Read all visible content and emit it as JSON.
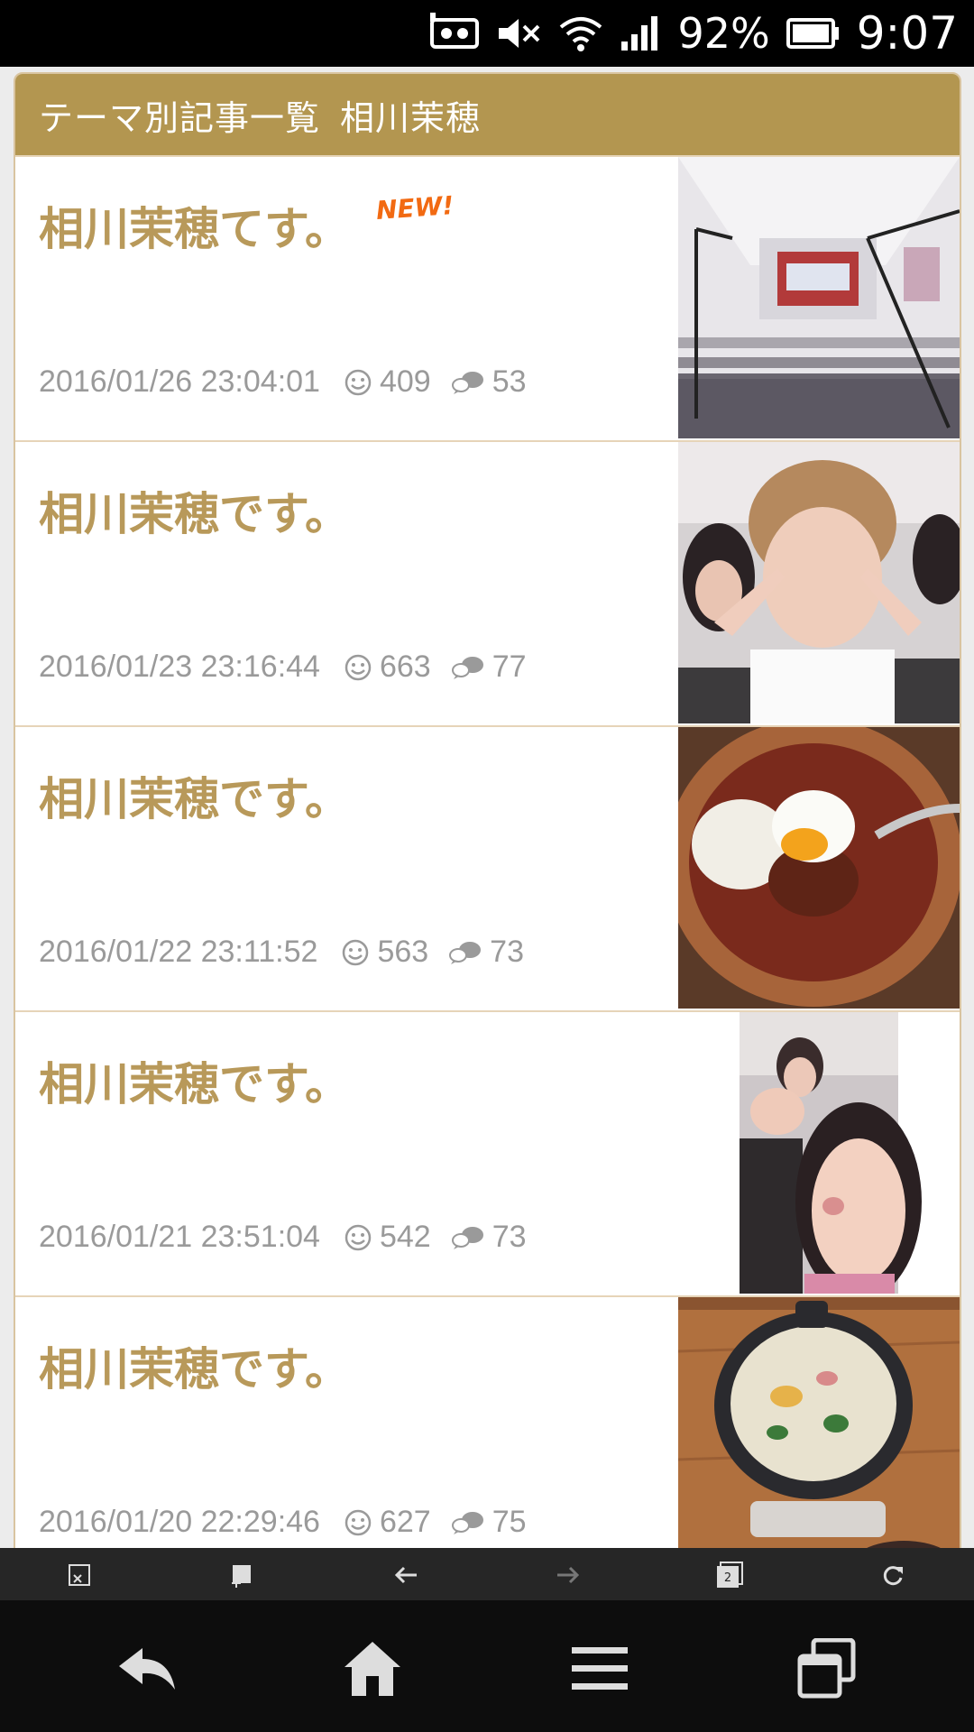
{
  "status_bar": {
    "battery_percent": "92%",
    "time": "9:07",
    "icons": [
      "nfc-icon",
      "mute-icon",
      "wifi-icon",
      "signal-icon",
      "battery-icon"
    ]
  },
  "header": {
    "title": "テーマ別記事一覧",
    "theme": "相川茉穂"
  },
  "entries": [
    {
      "title": "相川茉穂てす。",
      "badge": "NEW!",
      "date": "2016/01/26 23:04:01",
      "likes": "409",
      "comments": "53",
      "thumb": "gallery-photo"
    },
    {
      "title": "相川茉穂です。",
      "date": "2016/01/23 23:16:44",
      "likes": "663",
      "comments": "77",
      "thumb": "selfie-photo"
    },
    {
      "title": "相川茉穂です。",
      "date": "2016/01/22 23:11:52",
      "likes": "563",
      "comments": "73",
      "thumb": "curry-photo"
    },
    {
      "title": "相川茉穂です。",
      "date": "2016/01/21 23:51:04",
      "likes": "542",
      "comments": "73",
      "thumb": "friends-photo"
    },
    {
      "title": "相川茉穂です。",
      "date": "2016/01/20 22:29:46",
      "likes": "627",
      "comments": "75",
      "thumb": "stew-photo"
    }
  ],
  "browser_toolbar": {
    "tab_count": "2",
    "buttons": [
      "close-tab-icon",
      "add-bookmark-icon",
      "back-arrow-icon",
      "forward-arrow-icon",
      "tabs-icon",
      "reload-icon"
    ]
  },
  "nav_bar": {
    "buttons": [
      "back-icon",
      "home-icon",
      "menu-icon",
      "recent-apps-icon"
    ]
  },
  "colors": {
    "accent": "#b39650",
    "title_text": "#b8995a",
    "new_badge": "#f26a12",
    "meta_text": "#9a9a9a"
  }
}
